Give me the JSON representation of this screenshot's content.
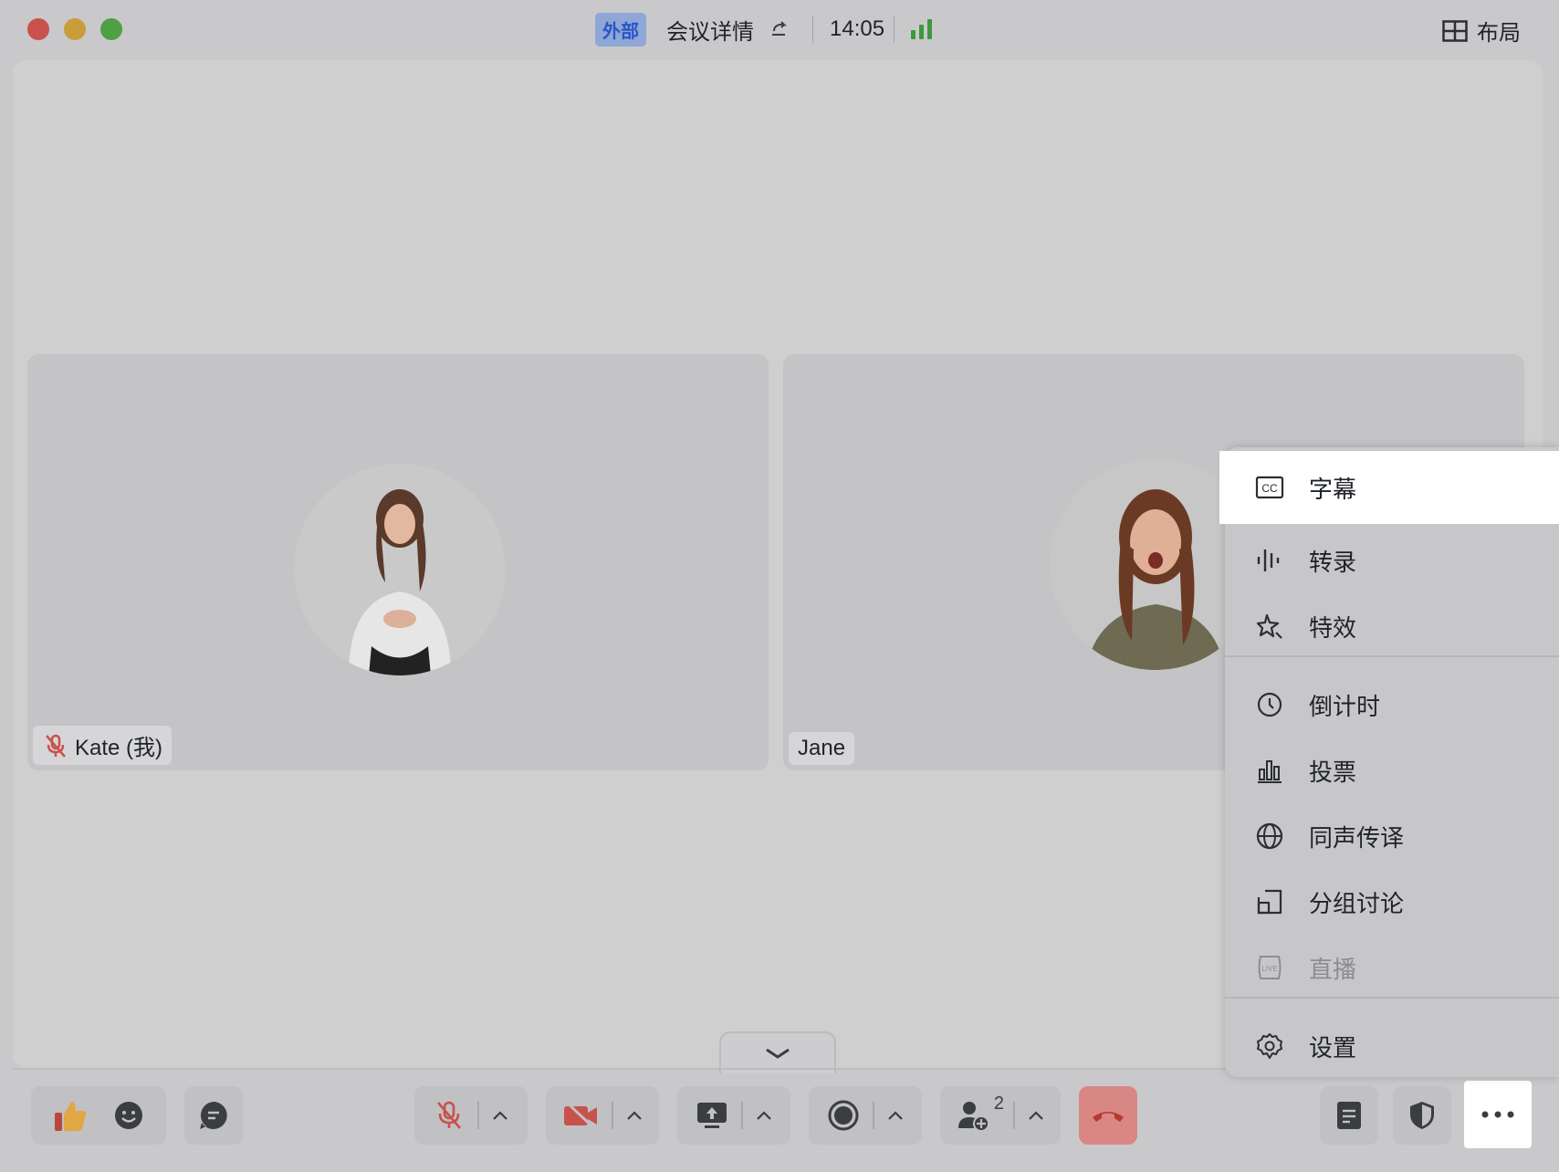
{
  "titlebar": {
    "badge": "外部",
    "meeting_details": "会议详情",
    "clock": "14:05",
    "layout_label": "布局"
  },
  "participants": [
    {
      "name": "Kate (我)",
      "muted": true
    },
    {
      "name": "Jane",
      "muted": false
    }
  ],
  "toolbar": {
    "participant_count": "2",
    "more": "..."
  },
  "menu": {
    "items": [
      {
        "label": "字幕",
        "icon": "cc-icon",
        "selected": true
      },
      {
        "label": "转录",
        "icon": "waveform-icon"
      },
      {
        "label": "特效",
        "icon": "sparkle-icon"
      },
      {
        "label": "倒计时",
        "icon": "timer-icon"
      },
      {
        "label": "投票",
        "icon": "poll-chart-icon"
      },
      {
        "label": "同声传译",
        "icon": "globe-icon"
      },
      {
        "label": "分组讨论",
        "icon": "breakout-rooms-icon"
      },
      {
        "label": "直播",
        "icon": "live-icon",
        "disabled": true
      },
      {
        "label": "设置",
        "icon": "gear-icon"
      }
    ]
  },
  "colors": {
    "accent_blue": "#2a55c8",
    "signal_green": "#3c9a3c",
    "danger_red": "#c8524b",
    "end_call_bg": "#d98785"
  }
}
